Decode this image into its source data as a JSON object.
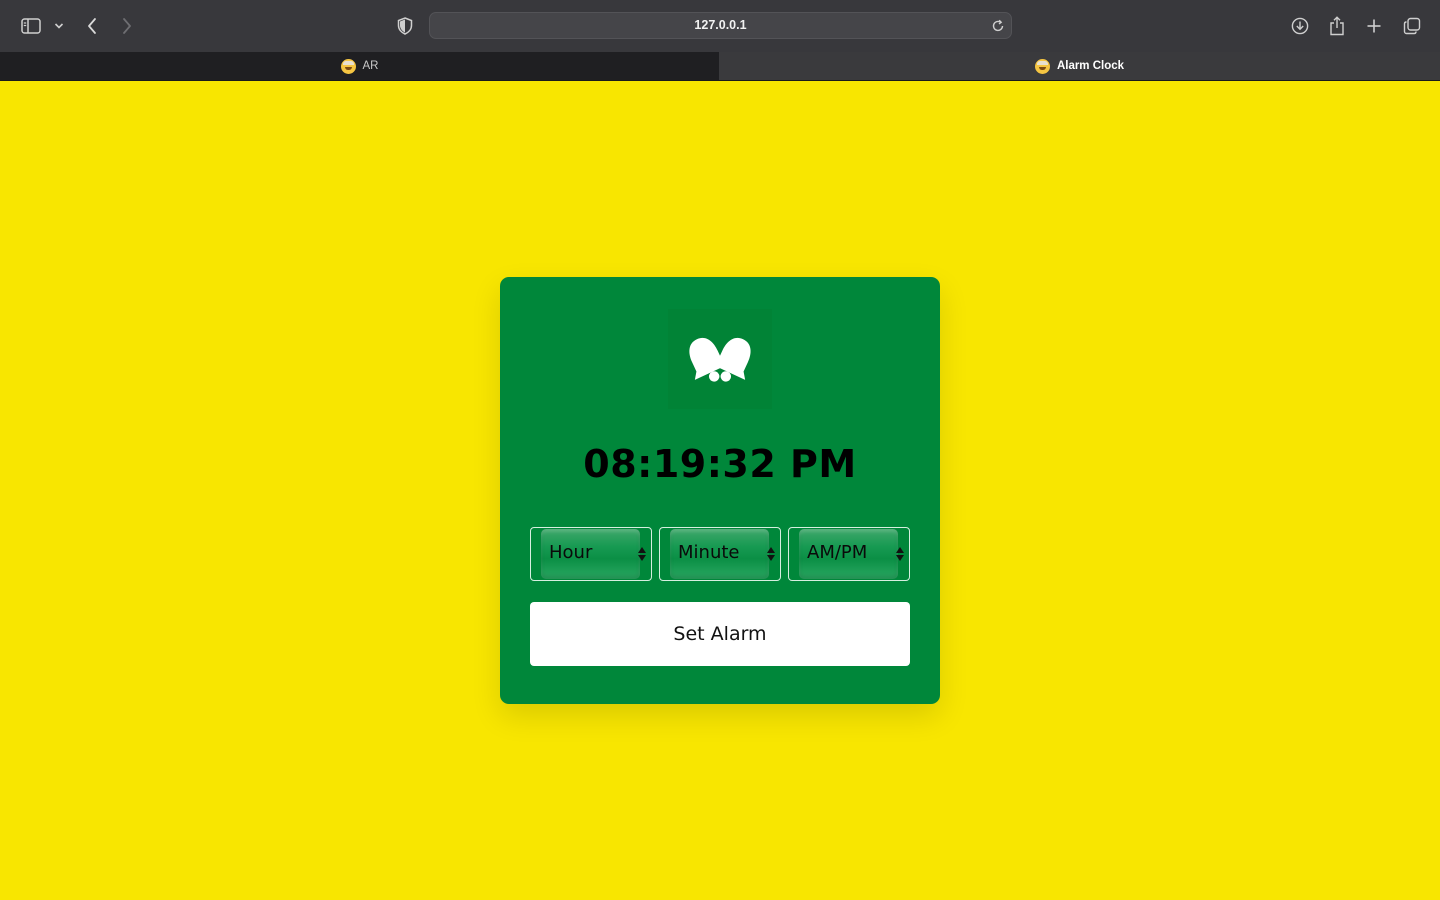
{
  "browser": {
    "url": "127.0.0.1",
    "tabs": [
      {
        "label": "AR",
        "active": false
      },
      {
        "label": "Alarm Clock",
        "active": true
      }
    ]
  },
  "page": {
    "background_color": "#f8e600",
    "card_color": "#00873a",
    "bell_icon": "bells-icon",
    "current_time": "08:19:32 PM",
    "selects": {
      "hour": "Hour",
      "minute": "Minute",
      "ampm": "AM/PM"
    },
    "set_alarm_label": "Set Alarm"
  }
}
